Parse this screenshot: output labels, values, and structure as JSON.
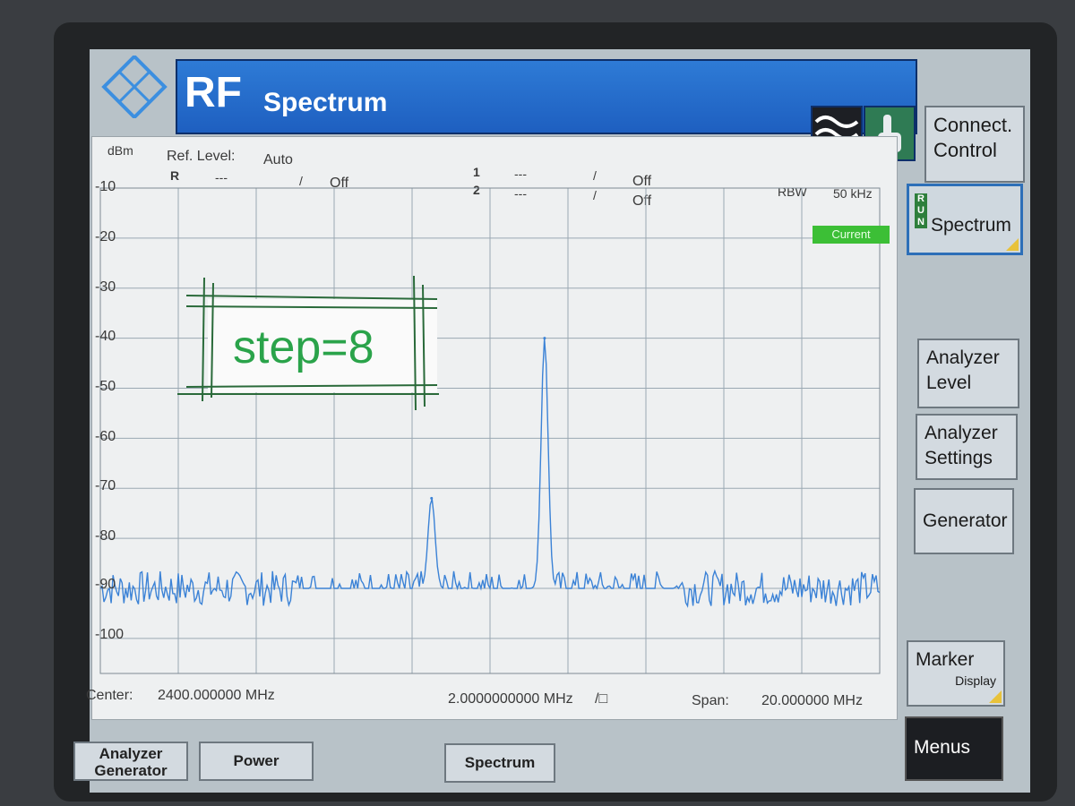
{
  "app": {
    "title_main": "RF",
    "title_sub": "Spectrum"
  },
  "colors": {
    "trace": "#3b82d6",
    "grid": "#9aa8b2",
    "title_bar": "#2e7bd6",
    "current_badge": "#3cbf36",
    "annotation": "#2aa34a"
  },
  "icons": [
    "rohde-schwarz-logo",
    "wave-icon",
    "hand-icon"
  ],
  "header": {
    "unit": "dBm",
    "ref_level_label": "Ref. Level:",
    "ref_level_value": "Auto",
    "r_marker": "R",
    "r_dashes": "---",
    "r_slash": "/",
    "r_state": "Off",
    "m1": "1",
    "m1_dashes": "---",
    "m1_slash": "/",
    "m1_state": "Off",
    "m2": "2",
    "m2_dashes": "---",
    "m2_slash": "/",
    "m2_state": "Off",
    "rbw_label": "RBW",
    "rbw_value": "50 kHz",
    "current_badge": "Current"
  },
  "annotation": {
    "text": "step=8"
  },
  "footer": {
    "center_label": "Center:",
    "center_value": "2400.000000 MHz",
    "scale_value": "2.0000000000 MHz",
    "scale_unit": "/□",
    "span_label": "Span:",
    "span_value": "20.000000 MHz"
  },
  "softkeys": {
    "connect_control": [
      "Connect.",
      "Control"
    ],
    "spectrum": "Spectrum",
    "run_letters": [
      "R",
      "U",
      "N"
    ],
    "analyzer_level": [
      "Analyzer",
      "Level"
    ],
    "analyzer_settings": [
      "Analyzer",
      "Settings"
    ],
    "generator": "Generator",
    "marker": "Marker",
    "marker_sub": "Display",
    "menus": "Menus"
  },
  "bottom_tabs": {
    "analyzer_generator": [
      "Analyzer",
      "Generator"
    ],
    "power": "Power",
    "spectrum": "Spectrum"
  },
  "chart_data": {
    "type": "line",
    "title": "",
    "xlabel": "",
    "ylabel": "dBm",
    "ylim": [
      -105,
      -10
    ],
    "xlim_mhz": [
      2390,
      2410
    ],
    "y_ticks": [
      -10,
      -20,
      -30,
      -40,
      -50,
      -60,
      -70,
      -80,
      -90,
      -100
    ],
    "y_tick_labels": [
      "-10",
      "-20",
      "-30",
      "-40",
      "-50",
      "-60",
      "-70",
      "-80",
      "-90",
      "-100"
    ],
    "grid": true,
    "series": [
      {
        "noise_floor_dbm": -90,
        "peaks": [
          {
            "x_mhz": 2398.5,
            "y_dbm": -72
          },
          {
            "x_mhz": 2401.4,
            "y_dbm": -40
          }
        ]
      }
    ]
  }
}
